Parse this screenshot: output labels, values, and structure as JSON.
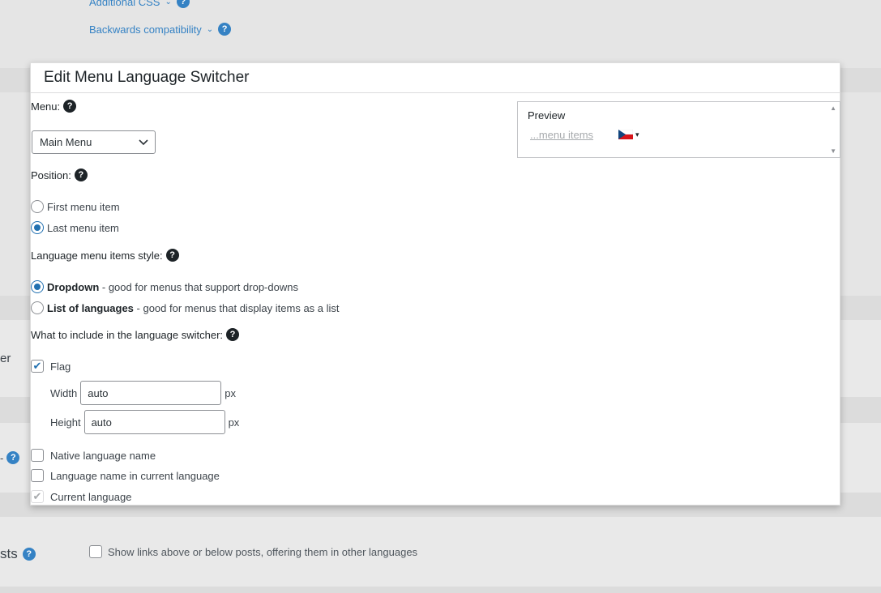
{
  "background": {
    "additional_css": "Additional CSS",
    "backwards_compat": "Backwards compatibility",
    "left_fragment_1": "er",
    "left_fragment_2": "-",
    "posts_label": "sts",
    "show_links_label": "Show links above or below posts, offering them in other languages"
  },
  "dialog": {
    "title": "Edit Menu Language Switcher",
    "menu_label": "Menu:",
    "menu_selected": "Main Menu",
    "position_label": "Position:",
    "position_options": [
      "First menu item",
      "Last menu item"
    ],
    "style_label": "Language menu items style:",
    "style_dropdown_bold": "Dropdown",
    "style_dropdown_desc": " - good for menus that support drop-downs",
    "style_list_bold": "List of languages",
    "style_list_desc": " - good for menus that display items as a list",
    "include_label": "What to include in the language switcher:",
    "flag_label": "Flag",
    "width_label": "Width",
    "width_value": "auto",
    "height_label": "Height",
    "height_value": "auto",
    "px": "px",
    "native_name_label": "Native language name",
    "current_lang_name_label": "Language name in current language",
    "current_language_label": "Current language",
    "qmark": "?"
  },
  "preview": {
    "title": "Preview",
    "link": "...menu items",
    "caret": "▾"
  },
  "colors": {
    "accent": "#2271b1",
    "help_blue": "#3582c4"
  }
}
